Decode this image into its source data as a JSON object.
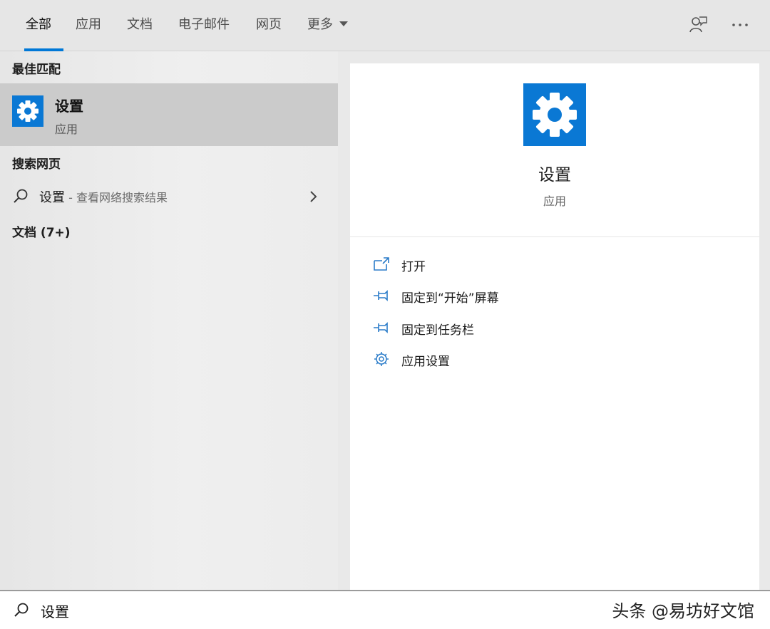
{
  "tabs": [
    {
      "label": "全部",
      "active": true
    },
    {
      "label": "应用"
    },
    {
      "label": "文档"
    },
    {
      "label": "电子邮件"
    },
    {
      "label": "网页"
    },
    {
      "label": "更多"
    }
  ],
  "top_icons": {
    "feedback": "feedback-icon",
    "more": "more-options-icon"
  },
  "left": {
    "best_match_title": "最佳匹配",
    "best_match": {
      "name": "设置",
      "type": "应用",
      "icon": "gear-icon"
    },
    "web_title": "搜索网页",
    "web_result": {
      "query": "设置",
      "hint": " - 查看网络搜索结果"
    },
    "docs_title": "文档 (7+)"
  },
  "detail": {
    "name": "设置",
    "type": "应用",
    "actions": [
      {
        "label": "打开",
        "icon": "open-icon"
      },
      {
        "label": "固定到“开始”屏幕",
        "icon": "pin-icon"
      },
      {
        "label": "固定到任务栏",
        "icon": "pin-icon"
      },
      {
        "label": "应用设置",
        "icon": "gear-icon"
      }
    ]
  },
  "search": {
    "value": "设置"
  },
  "watermark": "头条 @易坊好文馆",
  "colors": {
    "accent": "#0078d7",
    "tile": "#0a78d4"
  }
}
